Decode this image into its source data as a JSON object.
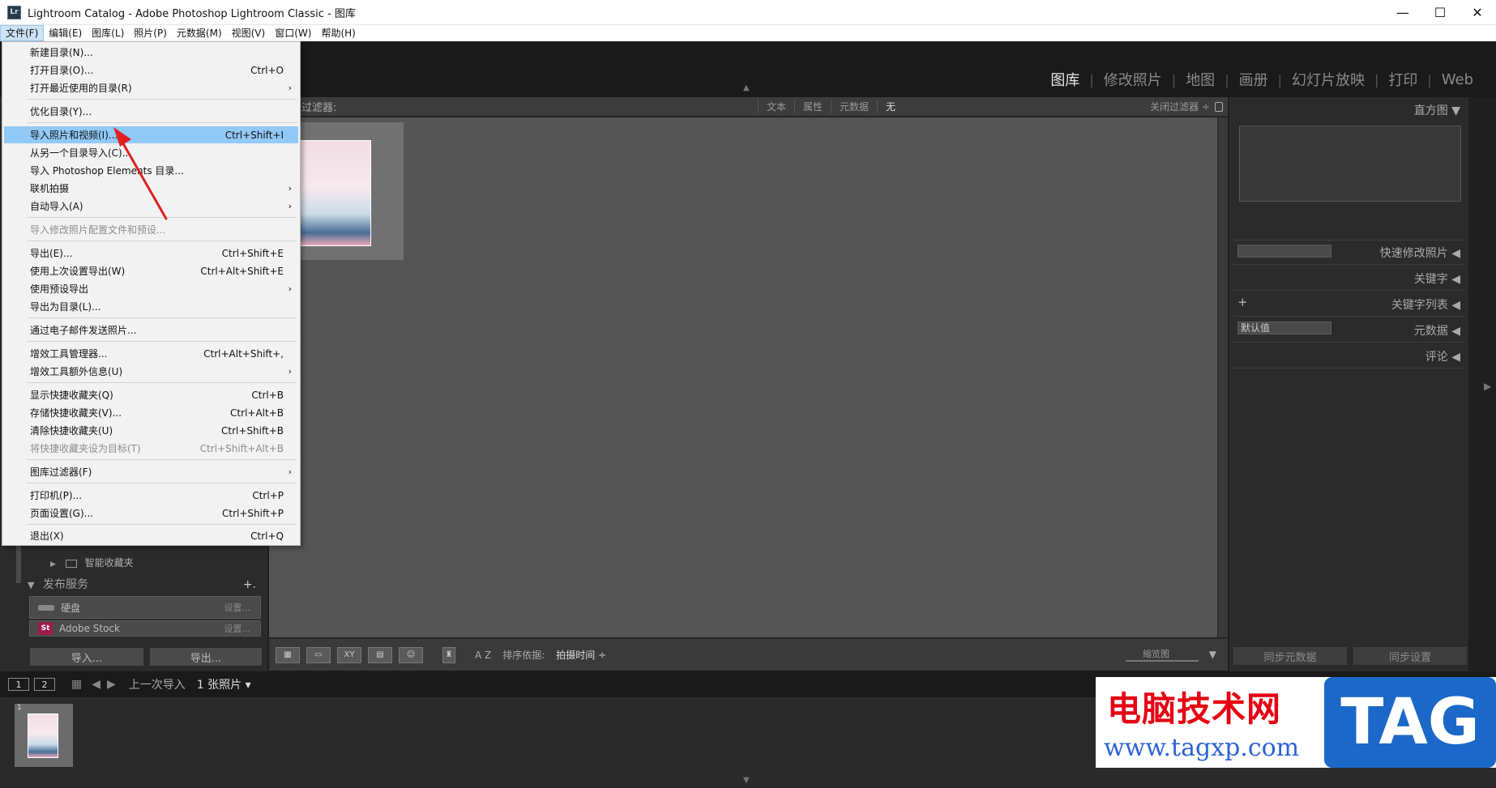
{
  "window": {
    "title": "Lightroom Catalog - Adobe Photoshop Lightroom Classic - 图库",
    "app_icon": "Lr",
    "minimize": "—",
    "maximize": "☐",
    "close": "✕"
  },
  "menubar": [
    "文件(F)",
    "编辑(E)",
    "图库(L)",
    "照片(P)",
    "元数据(M)",
    "视图(V)",
    "窗口(W)",
    "帮助(H)"
  ],
  "modules": [
    "图库",
    "修改照片",
    "地图",
    "画册",
    "幻灯片放映",
    "打印",
    "Web"
  ],
  "filter_bar": {
    "label": "过滤器:",
    "options": [
      "文本",
      "属性",
      "元数据",
      "无"
    ],
    "close": "关闭过滤器 ÷"
  },
  "file_menu": {
    "items": [
      {
        "label": "新建目录(N)...",
        "shortcut": ""
      },
      {
        "label": "打开目录(O)...",
        "shortcut": "Ctrl+O"
      },
      {
        "label": "打开最近使用的目录(R)",
        "shortcut": "",
        "submenu": "›"
      },
      {
        "label": "优化目录(Y)...",
        "shortcut": ""
      },
      {
        "label": "导入照片和视频(I)...",
        "shortcut": "Ctrl+Shift+I"
      },
      {
        "label": "从另一个目录导入(C)...",
        "shortcut": ""
      },
      {
        "label": "导入 Photoshop Elements 目录...",
        "shortcut": ""
      },
      {
        "label": "联机拍摄",
        "shortcut": "",
        "submenu": "›"
      },
      {
        "label": "自动导入(A)",
        "shortcut": "",
        "submenu": "›"
      },
      {
        "label": "导入修改照片配置文件和预设...",
        "shortcut": ""
      },
      {
        "label": "导出(E)...",
        "shortcut": "Ctrl+Shift+E"
      },
      {
        "label": "使用上次设置导出(W)",
        "shortcut": "Ctrl+Alt+Shift+E"
      },
      {
        "label": "使用预设导出",
        "shortcut": "",
        "submenu": "›"
      },
      {
        "label": "导出为目录(L)...",
        "shortcut": ""
      },
      {
        "label": "通过电子邮件发送照片...",
        "shortcut": ""
      },
      {
        "label": "增效工具管理器...",
        "shortcut": "Ctrl+Alt+Shift+,"
      },
      {
        "label": "增效工具额外信息(U)",
        "shortcut": "",
        "submenu": "›"
      },
      {
        "label": "显示快捷收藏夹(Q)",
        "shortcut": "Ctrl+B"
      },
      {
        "label": "存储快捷收藏夹(V)...",
        "shortcut": "Ctrl+Alt+B"
      },
      {
        "label": "清除快捷收藏夹(U)",
        "shortcut": "Ctrl+Shift+B"
      },
      {
        "label": "将快捷收藏夹设为目标(T)",
        "shortcut": "Ctrl+Shift+Alt+B"
      },
      {
        "label": "图库过滤器(F)",
        "shortcut": "",
        "submenu": "›"
      },
      {
        "label": "打印机(P)...",
        "shortcut": "Ctrl+P"
      },
      {
        "label": "页面设置(G)...",
        "shortcut": "Ctrl+Shift+P"
      },
      {
        "label": "退出(X)",
        "shortcut": "Ctrl+Q"
      }
    ]
  },
  "left_panel": {
    "smart_collections": "智能收藏夹",
    "publish_services": "发布服务",
    "publish_add": "+.",
    "services": [
      {
        "name": "硬盘",
        "setting": "设置..."
      },
      {
        "name": "Adobe Stock",
        "setting": "设置..."
      }
    ],
    "import_button": "导入...",
    "export_button": "导出..."
  },
  "right_panel": {
    "histogram": "直方图",
    "quick_develop": "快速修改照片",
    "keywording": "关键字",
    "keyword_list": "关键字列表",
    "keyword_add": "+",
    "metadata": "元数据",
    "metadata_preset": "默认值",
    "comments": "评论",
    "sync_metadata": "同步元数据",
    "sync_settings": "同步设置"
  },
  "toolbar": {
    "sort_label": "排序依据:",
    "sort_value": "拍摄时间 ÷",
    "thumbnail_label": "缩览图",
    "sort_direction": "A Z"
  },
  "filmstrip": {
    "screen1": "1",
    "screen2": "2",
    "source": "上一次导入",
    "count": "1 张照片 ▾",
    "thumb_index": "1"
  },
  "watermark": {
    "cn": "电脑技术网",
    "url": "www.tagxp.com",
    "tag": "TAG"
  },
  "colors": {
    "menu_hover": "#91c9f7",
    "arrow": "#e02020",
    "watermark_red": "#e60012",
    "watermark_blue": "#1b68c8"
  }
}
